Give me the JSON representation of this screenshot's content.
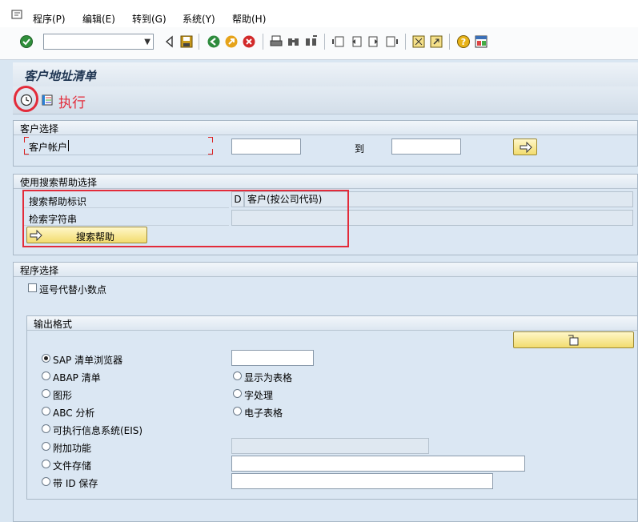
{
  "menu": {
    "items": [
      "程序(P)",
      "编辑(E)",
      "转到(G)",
      "系统(Y)",
      "帮助(H)"
    ]
  },
  "toolbar": {
    "command_value": "",
    "icons": [
      "enter-icon",
      "back-arrow-icon",
      "save-icon",
      "back-icon",
      "exit-icon",
      "cancel-icon",
      "print-icon",
      "find-icon",
      "find-next-icon",
      "first-page-icon",
      "previous-page-icon",
      "next-page-icon",
      "last-page-icon",
      "create-session-icon",
      "shortcut-icon",
      "help-icon",
      "layout-icon"
    ]
  },
  "title": "客户地址清单",
  "app_toolbar": {
    "execute_label": "执行"
  },
  "customer_selection": {
    "header": "客户选择",
    "account_label": "客户帐户",
    "from_value": "",
    "to_label": "到",
    "to_value": ""
  },
  "search_help": {
    "header": "使用搜索帮助选择",
    "id_label": "搜索帮助标识",
    "id_code": "D",
    "id_description": "客户(按公司代码)",
    "search_string_label": "检索字符串",
    "search_string_value": "",
    "button_label": "搜索帮助"
  },
  "program_selection": {
    "header": "程序选择",
    "comma_decimal_label": "逗号代替小数点",
    "comma_decimal_checked": false
  },
  "output_format": {
    "header": "输出格式",
    "options": [
      {
        "label": "SAP 清单浏览器",
        "selected": true
      },
      {
        "label": "ABAP 清单",
        "selected": false
      },
      {
        "label": "图形",
        "selected": false
      },
      {
        "label": "ABC 分析",
        "selected": false
      },
      {
        "label": "可执行信息系统(EIS)",
        "selected": false
      },
      {
        "label": "附加功能",
        "selected": false
      },
      {
        "label": "文件存储",
        "selected": false
      },
      {
        "label": "带 ID 保存",
        "selected": false
      }
    ],
    "right_options": [
      {
        "label": "显示为表格",
        "selected": false
      },
      {
        "label": "字处理",
        "selected": false
      },
      {
        "label": "电子表格",
        "selected": false
      }
    ],
    "variant_value": "",
    "extra_value": "",
    "file_value": "",
    "id_value": ""
  },
  "colors": {
    "highlight_red": "#e32b3a",
    "button_yellow": "#f2dc6e",
    "panel_blue": "#dbe7f3"
  }
}
